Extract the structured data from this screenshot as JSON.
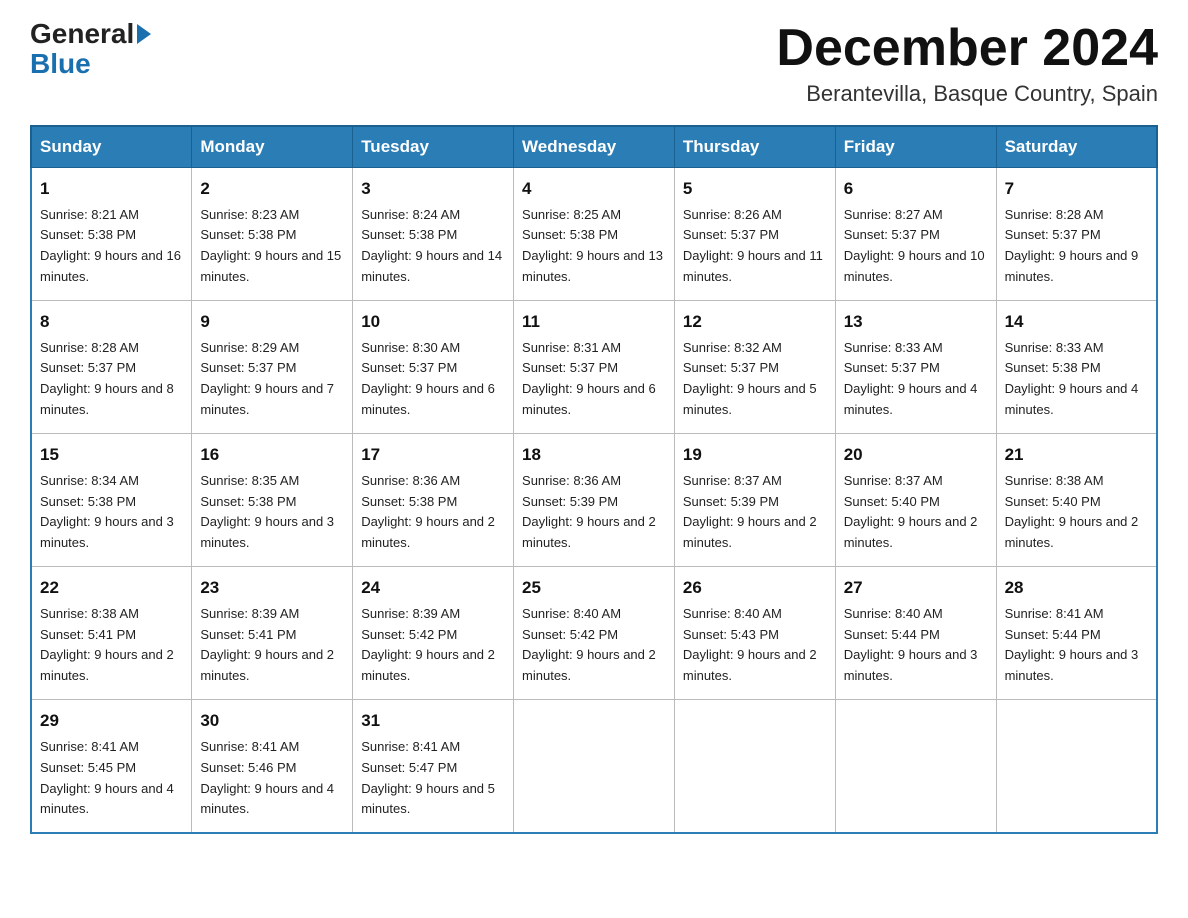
{
  "header": {
    "logo_general": "General",
    "logo_blue": "Blue",
    "month_title": "December 2024",
    "location": "Berantevilla, Basque Country, Spain"
  },
  "days_of_week": [
    "Sunday",
    "Monday",
    "Tuesday",
    "Wednesday",
    "Thursday",
    "Friday",
    "Saturday"
  ],
  "weeks": [
    [
      {
        "day": "1",
        "sunrise": "8:21 AM",
        "sunset": "5:38 PM",
        "daylight": "9 hours and 16 minutes."
      },
      {
        "day": "2",
        "sunrise": "8:23 AM",
        "sunset": "5:38 PM",
        "daylight": "9 hours and 15 minutes."
      },
      {
        "day": "3",
        "sunrise": "8:24 AM",
        "sunset": "5:38 PM",
        "daylight": "9 hours and 14 minutes."
      },
      {
        "day": "4",
        "sunrise": "8:25 AM",
        "sunset": "5:38 PM",
        "daylight": "9 hours and 13 minutes."
      },
      {
        "day": "5",
        "sunrise": "8:26 AM",
        "sunset": "5:37 PM",
        "daylight": "9 hours and 11 minutes."
      },
      {
        "day": "6",
        "sunrise": "8:27 AM",
        "sunset": "5:37 PM",
        "daylight": "9 hours and 10 minutes."
      },
      {
        "day": "7",
        "sunrise": "8:28 AM",
        "sunset": "5:37 PM",
        "daylight": "9 hours and 9 minutes."
      }
    ],
    [
      {
        "day": "8",
        "sunrise": "8:28 AM",
        "sunset": "5:37 PM",
        "daylight": "9 hours and 8 minutes."
      },
      {
        "day": "9",
        "sunrise": "8:29 AM",
        "sunset": "5:37 PM",
        "daylight": "9 hours and 7 minutes."
      },
      {
        "day": "10",
        "sunrise": "8:30 AM",
        "sunset": "5:37 PM",
        "daylight": "9 hours and 6 minutes."
      },
      {
        "day": "11",
        "sunrise": "8:31 AM",
        "sunset": "5:37 PM",
        "daylight": "9 hours and 6 minutes."
      },
      {
        "day": "12",
        "sunrise": "8:32 AM",
        "sunset": "5:37 PM",
        "daylight": "9 hours and 5 minutes."
      },
      {
        "day": "13",
        "sunrise": "8:33 AM",
        "sunset": "5:37 PM",
        "daylight": "9 hours and 4 minutes."
      },
      {
        "day": "14",
        "sunrise": "8:33 AM",
        "sunset": "5:38 PM",
        "daylight": "9 hours and 4 minutes."
      }
    ],
    [
      {
        "day": "15",
        "sunrise": "8:34 AM",
        "sunset": "5:38 PM",
        "daylight": "9 hours and 3 minutes."
      },
      {
        "day": "16",
        "sunrise": "8:35 AM",
        "sunset": "5:38 PM",
        "daylight": "9 hours and 3 minutes."
      },
      {
        "day": "17",
        "sunrise": "8:36 AM",
        "sunset": "5:38 PM",
        "daylight": "9 hours and 2 minutes."
      },
      {
        "day": "18",
        "sunrise": "8:36 AM",
        "sunset": "5:39 PM",
        "daylight": "9 hours and 2 minutes."
      },
      {
        "day": "19",
        "sunrise": "8:37 AM",
        "sunset": "5:39 PM",
        "daylight": "9 hours and 2 minutes."
      },
      {
        "day": "20",
        "sunrise": "8:37 AM",
        "sunset": "5:40 PM",
        "daylight": "9 hours and 2 minutes."
      },
      {
        "day": "21",
        "sunrise": "8:38 AM",
        "sunset": "5:40 PM",
        "daylight": "9 hours and 2 minutes."
      }
    ],
    [
      {
        "day": "22",
        "sunrise": "8:38 AM",
        "sunset": "5:41 PM",
        "daylight": "9 hours and 2 minutes."
      },
      {
        "day": "23",
        "sunrise": "8:39 AM",
        "sunset": "5:41 PM",
        "daylight": "9 hours and 2 minutes."
      },
      {
        "day": "24",
        "sunrise": "8:39 AM",
        "sunset": "5:42 PM",
        "daylight": "9 hours and 2 minutes."
      },
      {
        "day": "25",
        "sunrise": "8:40 AM",
        "sunset": "5:42 PM",
        "daylight": "9 hours and 2 minutes."
      },
      {
        "day": "26",
        "sunrise": "8:40 AM",
        "sunset": "5:43 PM",
        "daylight": "9 hours and 2 minutes."
      },
      {
        "day": "27",
        "sunrise": "8:40 AM",
        "sunset": "5:44 PM",
        "daylight": "9 hours and 3 minutes."
      },
      {
        "day": "28",
        "sunrise": "8:41 AM",
        "sunset": "5:44 PM",
        "daylight": "9 hours and 3 minutes."
      }
    ],
    [
      {
        "day": "29",
        "sunrise": "8:41 AM",
        "sunset": "5:45 PM",
        "daylight": "9 hours and 4 minutes."
      },
      {
        "day": "30",
        "sunrise": "8:41 AM",
        "sunset": "5:46 PM",
        "daylight": "9 hours and 4 minutes."
      },
      {
        "day": "31",
        "sunrise": "8:41 AM",
        "sunset": "5:47 PM",
        "daylight": "9 hours and 5 minutes."
      },
      null,
      null,
      null,
      null
    ]
  ]
}
